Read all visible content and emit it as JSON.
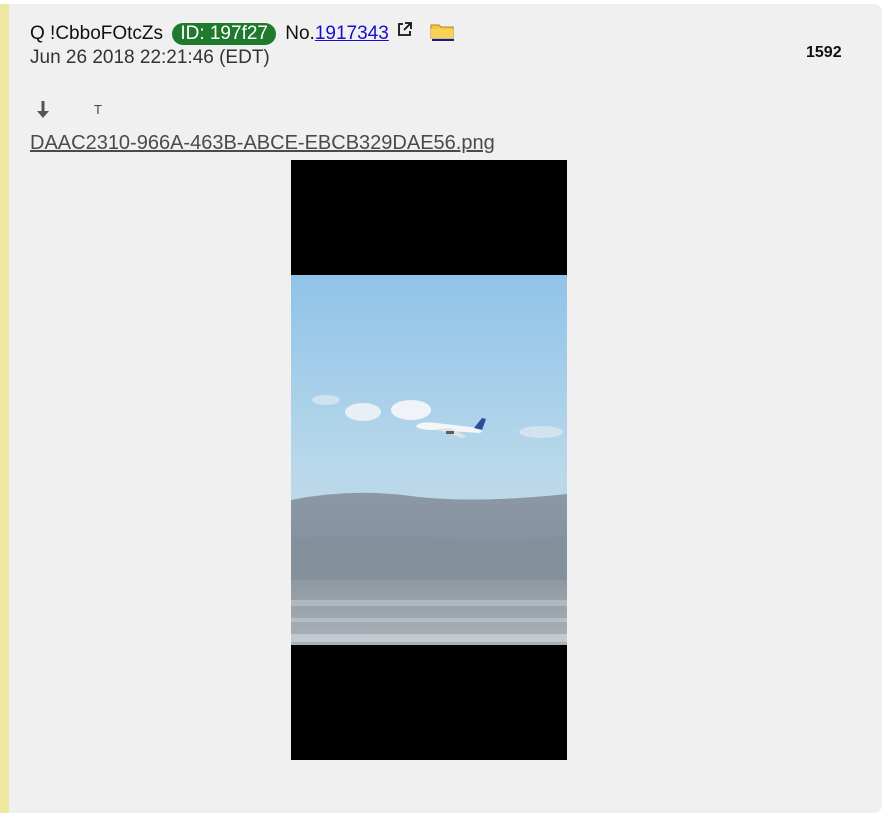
{
  "post": {
    "author": "Q !CbboFOtcZs",
    "id_badge": "ID: 197f27",
    "no_prefix": "No.",
    "post_number": "1917343",
    "date": "Jun 26 2018 22:21:46 (EDT)",
    "count": "1592",
    "text_toggle": "T",
    "filename": "DAAC2310-966A-463B-ABCE-EBCB329DAE56.png",
    "icons": {
      "external": "external-link-icon",
      "folder": "folder-icon",
      "download": "download-arrow-icon"
    },
    "colors": {
      "id_badge": "#1f7a2e",
      "link": "#1a0dcc",
      "accent": "#eee8a0",
      "background": "#f0f0f0"
    }
  }
}
